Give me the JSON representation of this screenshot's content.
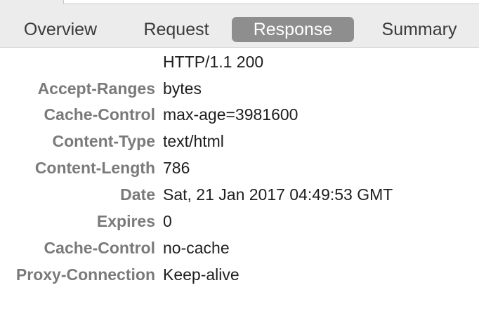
{
  "tabs": [
    {
      "label": "Overview",
      "selected": false
    },
    {
      "label": "Request",
      "selected": false
    },
    {
      "label": "Response",
      "selected": true
    },
    {
      "label": "Summary",
      "selected": false
    }
  ],
  "response": {
    "status_line": "HTTP/1.1 200",
    "headers": [
      {
        "name": "Accept-Ranges",
        "value": "bytes"
      },
      {
        "name": "Cache-Control",
        "value": "max-age=3981600"
      },
      {
        "name": "Content-Type",
        "value": "text/html"
      },
      {
        "name": "Content-Length",
        "value": "786"
      },
      {
        "name": "Date",
        "value": "Sat, 21 Jan 2017 04:49:53 GMT"
      },
      {
        "name": "Expires",
        "value": "0"
      },
      {
        "name": "Cache-Control",
        "value": "no-cache"
      },
      {
        "name": "Proxy-Connection",
        "value": "Keep-alive"
      }
    ]
  },
  "colors": {
    "tab_selected_bg": "#8e8e8e",
    "header_name": "#7a7a7a",
    "header_value": "#1e1e1e"
  }
}
